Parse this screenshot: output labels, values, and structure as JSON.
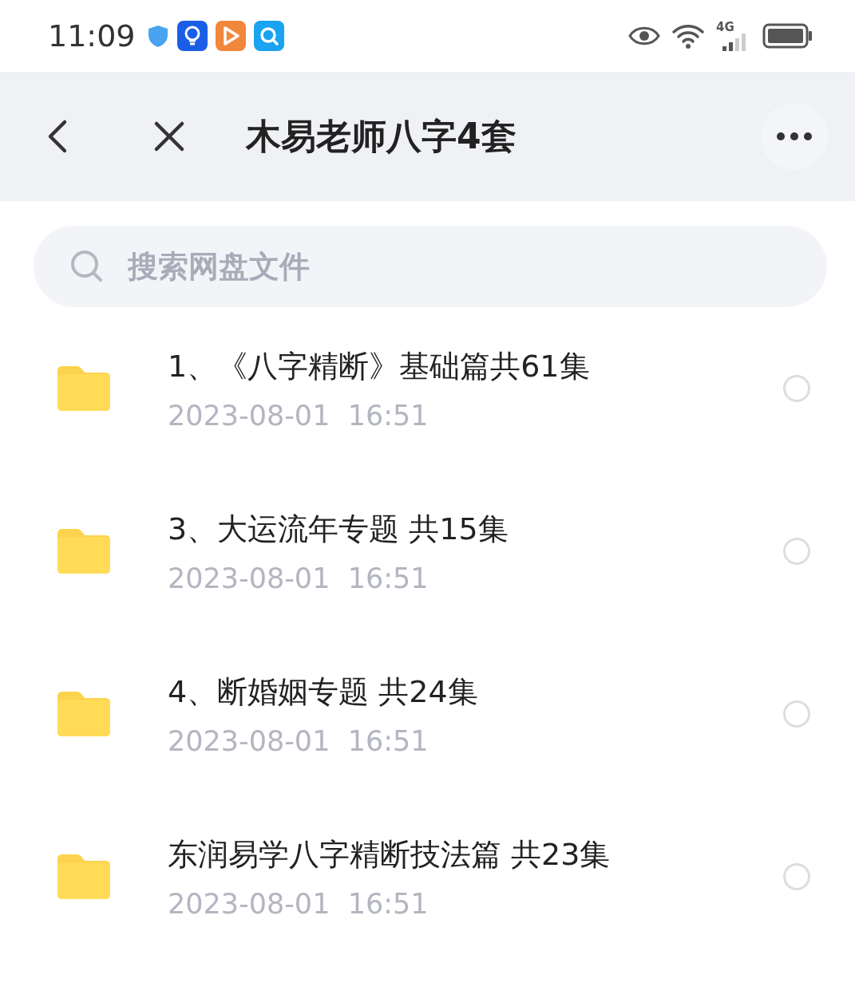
{
  "status_bar": {
    "time": "11:09",
    "network": "4G"
  },
  "header": {
    "title": "木易老师八字4套"
  },
  "search": {
    "placeholder": "搜索网盘文件"
  },
  "files": [
    {
      "name": "1、《八字精断》基础篇共61集",
      "date": "2023-08-01  16:51",
      "selected": false
    },
    {
      "name": "3、大运流年专题 共15集",
      "date": "2023-08-01  16:51",
      "selected": false
    },
    {
      "name": "4、断婚姻专题 共24集",
      "date": "2023-08-01  16:51",
      "selected": false
    },
    {
      "name": "东润易学八字精断技法篇 共23集",
      "date": "2023-08-01  16:51",
      "selected": false
    }
  ]
}
